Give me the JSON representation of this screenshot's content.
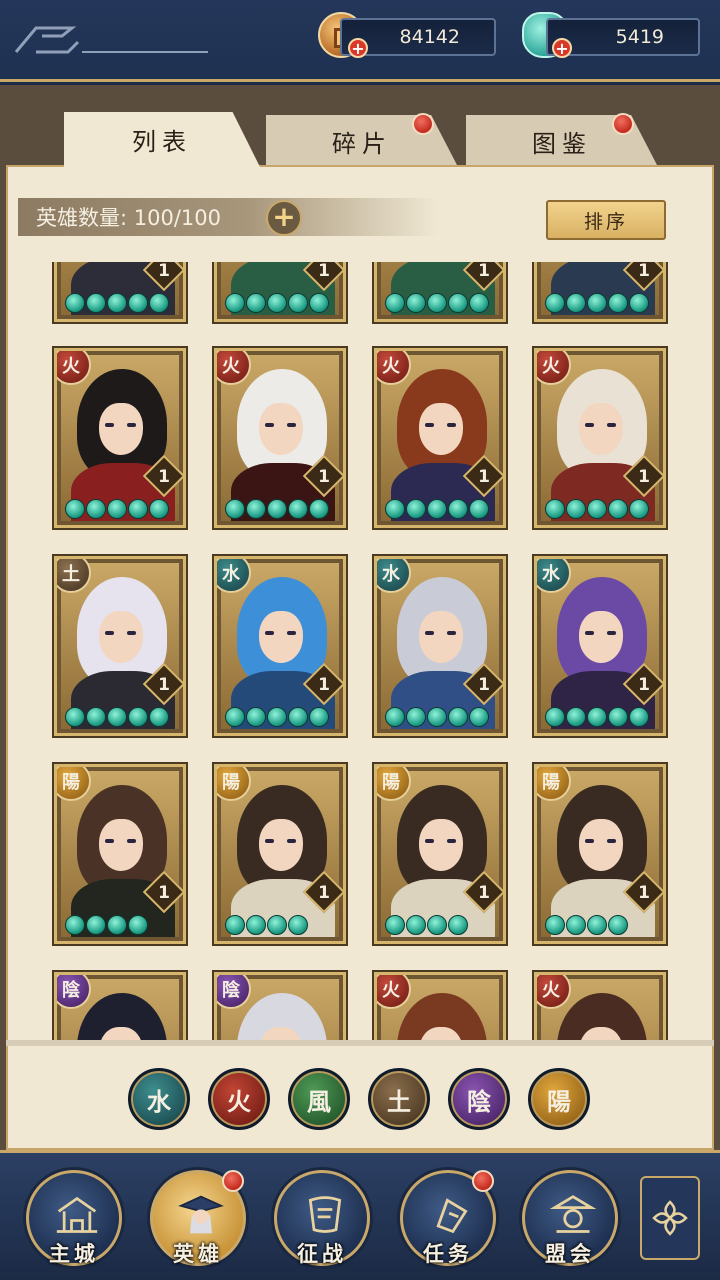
{
  "resources": {
    "coin": {
      "value": "84142",
      "icon": "copper-coin-icon"
    },
    "jade": {
      "value": "5419",
      "icon": "jade-pouch-icon"
    }
  },
  "tabs": [
    {
      "label": "列表",
      "active": true,
      "badge": false
    },
    {
      "label": "碎片",
      "active": false,
      "badge": true
    },
    {
      "label": "图鉴",
      "active": false,
      "badge": true
    }
  ],
  "hero_count": {
    "label": "英雄数量: 100/100"
  },
  "sort": {
    "label": "排序"
  },
  "elements": {
    "fire": "火",
    "earth": "土",
    "water": "水",
    "yang": "陽",
    "yin": "陰",
    "wind": "風"
  },
  "heroes": [
    {
      "element": "",
      "level": "1",
      "stars": 5,
      "hair": "#e8e0d0",
      "outfit": "#2d2d3a"
    },
    {
      "element": "",
      "level": "1",
      "stars": 5,
      "hair": "#3a5a2a",
      "outfit": "#2a5e44"
    },
    {
      "element": "",
      "level": "1",
      "stars": 5,
      "hair": "#3a5a2a",
      "outfit": "#2a5e44"
    },
    {
      "element": "",
      "level": "1",
      "stars": 5,
      "hair": "#3a4a5a",
      "outfit": "#2a3a50"
    },
    {
      "element": "fire",
      "level": "1",
      "stars": 5,
      "hair": "#1e1a1a",
      "outfit": "#8a1f1f"
    },
    {
      "element": "fire",
      "level": "1",
      "stars": 5,
      "hair": "#ecebe8",
      "outfit": "#3b1414"
    },
    {
      "element": "fire",
      "level": "1",
      "stars": 5,
      "hair": "#8a3a1c",
      "outfit": "#2c2a52"
    },
    {
      "element": "fire",
      "level": "1",
      "stars": 5,
      "hair": "#e9e2d4",
      "outfit": "#7e2a22"
    },
    {
      "element": "earth",
      "level": "1",
      "stars": 5,
      "hair": "#e6e2ee",
      "outfit": "#2b2a33"
    },
    {
      "element": "water",
      "level": "1",
      "stars": 5,
      "hair": "#3d8fd8",
      "outfit": "#244a7a"
    },
    {
      "element": "water",
      "level": "1",
      "stars": 5,
      "hair": "#c9ccd6",
      "outfit": "#2f4f86"
    },
    {
      "element": "water",
      "level": "1",
      "stars": 5,
      "hair": "#6b4aa6",
      "outfit": "#2f2446"
    },
    {
      "element": "yang",
      "level": "1",
      "stars": 4,
      "hair": "#4a3326",
      "outfit": "#23251f"
    },
    {
      "element": "yang",
      "level": "1",
      "stars": 4,
      "hair": "#3a2b22",
      "outfit": "#dcd3bf"
    },
    {
      "element": "yang",
      "level": "1",
      "stars": 4,
      "hair": "#3a2b22",
      "outfit": "#dcd3bf"
    },
    {
      "element": "yang",
      "level": "1",
      "stars": 4,
      "hair": "#3a2b22",
      "outfit": "#dcd3bf"
    },
    {
      "element": "yin",
      "level": "",
      "stars": 0,
      "hair": "#1e2030",
      "outfit": "#2a2a3a"
    },
    {
      "element": "yin",
      "level": "",
      "stars": 0,
      "hair": "#d8d8e0",
      "outfit": "#3a3650"
    },
    {
      "element": "fire",
      "level": "",
      "stars": 0,
      "hair": "#7a3a22",
      "outfit": "#5a2a22"
    },
    {
      "element": "fire",
      "level": "",
      "stars": 0,
      "hair": "#4a2c22",
      "outfit": "#3a2220"
    }
  ],
  "filters": [
    {
      "element": "water",
      "label": "水"
    },
    {
      "element": "fire",
      "label": "火"
    },
    {
      "element": "wind",
      "label": "風"
    },
    {
      "element": "earth",
      "label": "土"
    },
    {
      "element": "yin",
      "label": "陰"
    },
    {
      "element": "yang",
      "label": "陽"
    }
  ],
  "nav": [
    {
      "label": "主城",
      "icon": "city-gate-icon",
      "active": false,
      "badge": false
    },
    {
      "label": "英雄",
      "icon": "hero-portrait-icon",
      "active": true,
      "badge": true
    },
    {
      "label": "征战",
      "icon": "battle-scroll-icon",
      "active": false,
      "badge": false
    },
    {
      "label": "任务",
      "icon": "task-bell-icon",
      "active": false,
      "badge": true
    },
    {
      "label": "盟会",
      "icon": "guild-pavilion-icon",
      "active": false,
      "badge": false
    }
  ],
  "nav_more_icon": "menu-flower-icon"
}
